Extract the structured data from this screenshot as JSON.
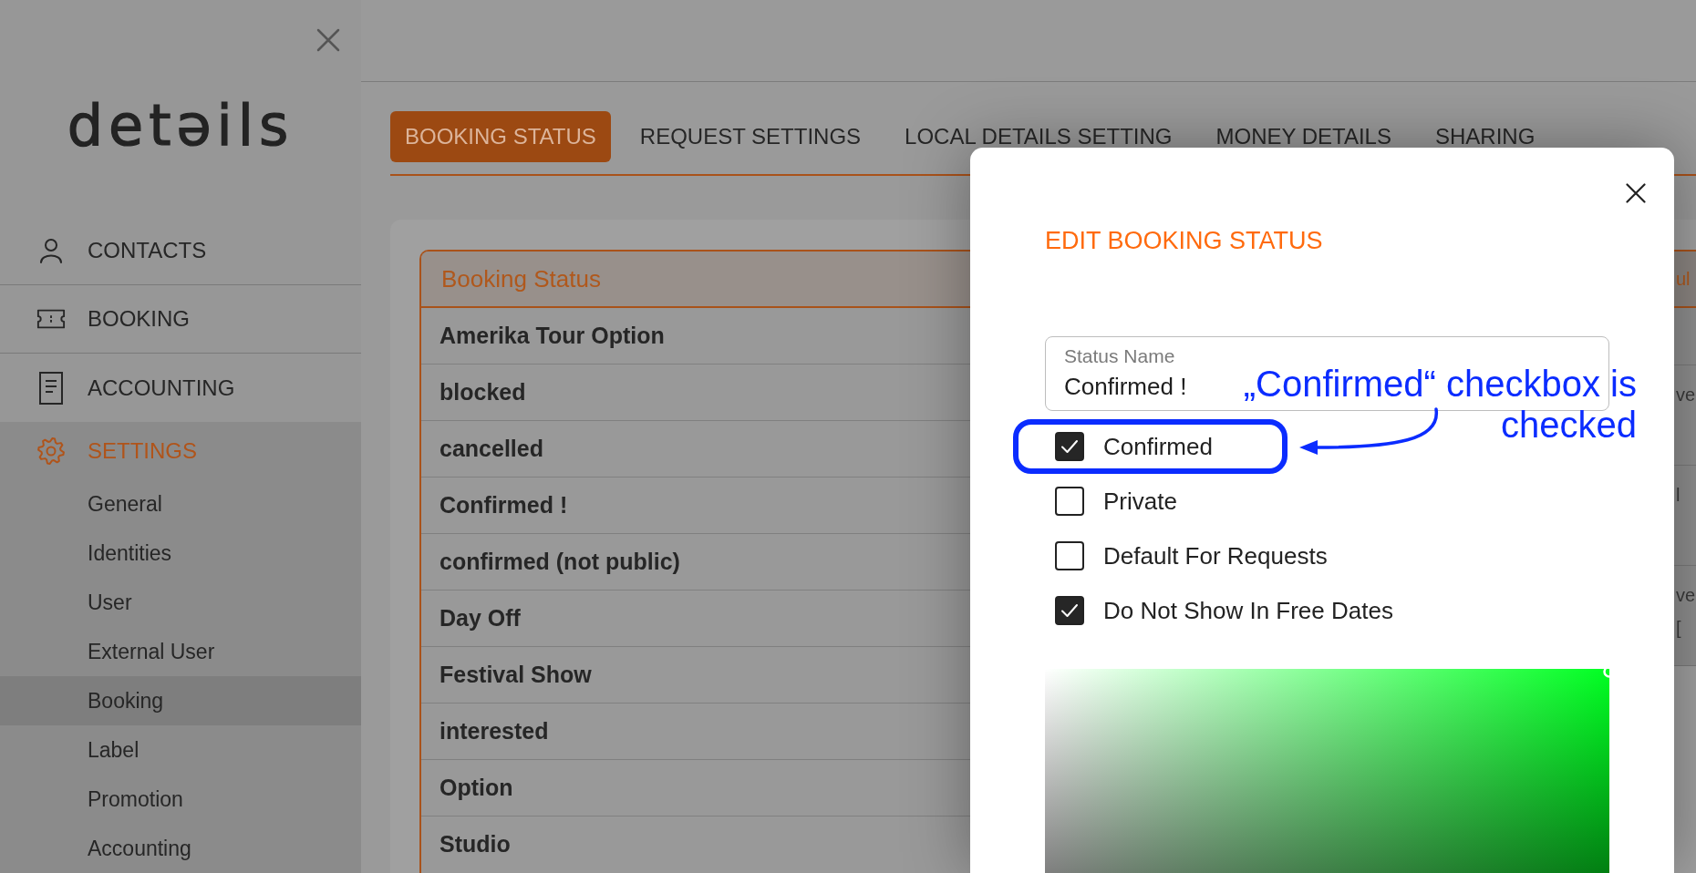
{
  "sidebar": {
    "logo": "detəils",
    "nav": [
      {
        "label": "CONTACTS",
        "selected": false
      },
      {
        "label": "BOOKING",
        "selected": false
      },
      {
        "label": "ACCOUNTING",
        "selected": false
      },
      {
        "label": "SETTINGS",
        "selected": true,
        "children": [
          {
            "label": "General",
            "selected": false
          },
          {
            "label": "Identities",
            "selected": false
          },
          {
            "label": "User",
            "selected": false
          },
          {
            "label": "External User",
            "selected": false
          },
          {
            "label": "Booking",
            "selected": true
          },
          {
            "label": "Label",
            "selected": false
          },
          {
            "label": "Promotion",
            "selected": false
          },
          {
            "label": "Accounting",
            "selected": false
          }
        ]
      }
    ]
  },
  "tabs": [
    {
      "label": "BOOKING STATUS",
      "selected": true
    },
    {
      "label": "REQUEST SETTINGS",
      "selected": false
    },
    {
      "label": "LOCAL DETAILS SETTING",
      "selected": false
    },
    {
      "label": "MONEY DETAILS",
      "selected": false
    },
    {
      "label": "SHARING",
      "selected": false
    }
  ],
  "table": {
    "columns": [
      "Booking Status"
    ],
    "rows": [
      "Amerika Tour Option",
      "blocked",
      "cancelled",
      "Confirmed !",
      "confirmed (not public)",
      "Day Off",
      "Festival Show",
      "interested",
      "Option",
      "Studio"
    ]
  },
  "second_card": {
    "heading": "ul",
    "rows": [
      [
        "ve"
      ],
      [
        "l"
      ],
      [
        "ve",
        "["
      ]
    ]
  },
  "modal": {
    "title": "EDIT BOOKING STATUS",
    "status_field": {
      "label": "Status Name",
      "value": "Confirmed !"
    },
    "checkboxes": [
      {
        "label": "Confirmed",
        "checked": true,
        "highlighted": true
      },
      {
        "label": "Private",
        "checked": false,
        "highlighted": false
      },
      {
        "label": "Default For Requests",
        "checked": false,
        "highlighted": false
      },
      {
        "label": "Do Not Show In Free Dates",
        "checked": true,
        "highlighted": false
      }
    ]
  },
  "annotation": {
    "lines": [
      "„Confirmed“ checkbox is",
      "checked"
    ]
  }
}
